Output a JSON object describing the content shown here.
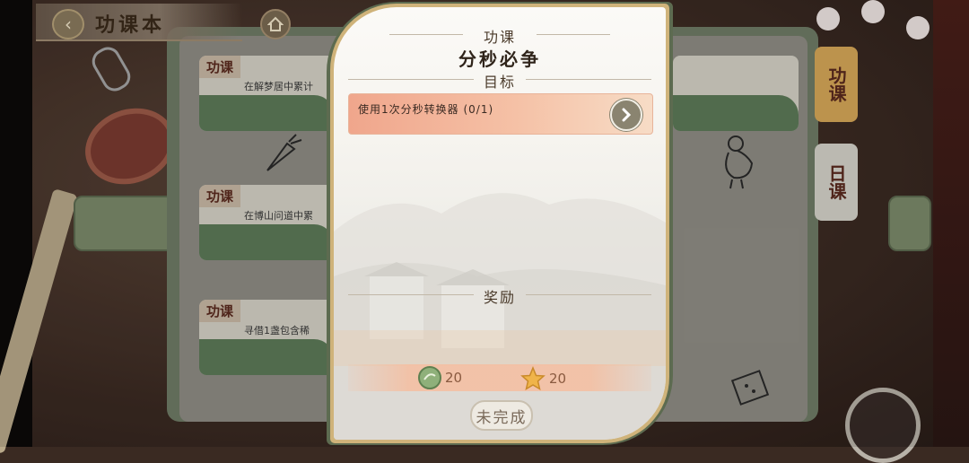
{
  "header": {
    "title": "功课本"
  },
  "quest_cards": [
    {
      "tag": "功课",
      "desc": "在解梦居中累计"
    },
    {
      "tag": "功课",
      "desc": "在博山问道中累"
    },
    {
      "tag": "功课",
      "desc": "寻借1盏包含稀"
    }
  ],
  "side_tabs": [
    {
      "label": "功课",
      "active": true
    },
    {
      "label": "日课",
      "active": false
    }
  ],
  "modal": {
    "kicker": "功课",
    "title": "分秒必争",
    "objective_header": "目标",
    "objective": {
      "text": "使用1次分秒转换器",
      "progress_text": "(0/1)"
    },
    "rewards_header": "奖励",
    "rewards": [
      {
        "icon": "jade-coin-icon",
        "amount": "20"
      },
      {
        "icon": "star-icon",
        "amount": "20"
      }
    ],
    "status_label": "未完成"
  },
  "colors": {
    "accent_gold": "#cfb37a",
    "objective_fill": "#f0a68c",
    "active_tab": "#d7a858",
    "modal_frame": "#5d6b50"
  }
}
